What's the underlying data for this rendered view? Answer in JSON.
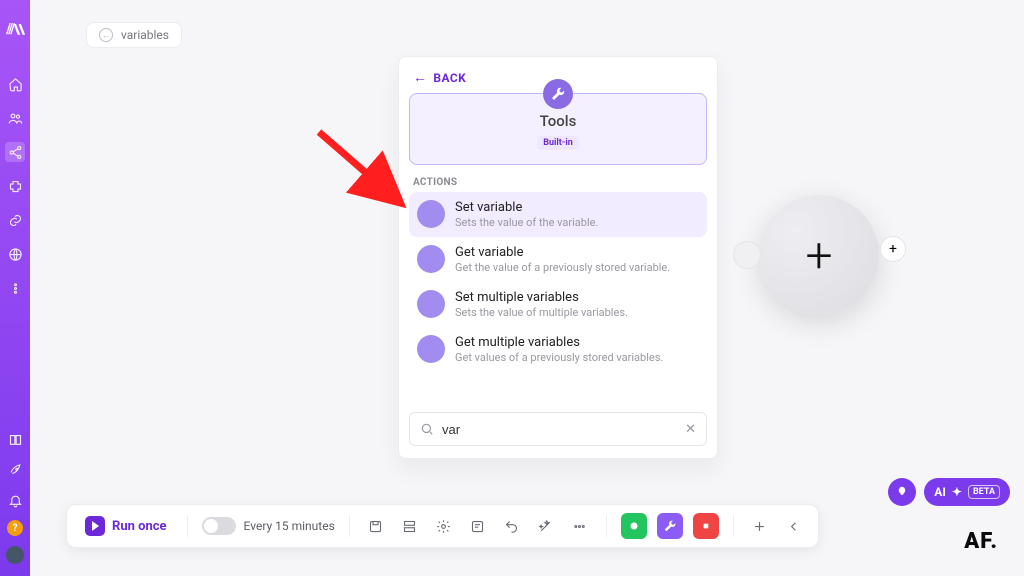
{
  "breadcrumb": {
    "label": "variables"
  },
  "panel": {
    "back_label": "BACK",
    "tool": {
      "title": "Tools",
      "tag": "Built-in"
    },
    "section_label": "ACTIONS",
    "actions": [
      {
        "title": "Set variable",
        "desc": "Sets the value of the variable.",
        "icon": "download"
      },
      {
        "title": "Get variable",
        "desc": "Get the value of a previously stored variable.",
        "icon": "upload"
      },
      {
        "title": "Set multiple variables",
        "desc": "Sets the value of multiple variables.",
        "icon": "upload"
      },
      {
        "title": "Get multiple variables",
        "desc": "Get values of a previously stored variables.",
        "icon": "upload"
      }
    ],
    "search": {
      "value": "var",
      "placeholder": ""
    }
  },
  "toolbar": {
    "run_label": "Run once",
    "schedule_label": "Every 15 minutes"
  },
  "ai_cta": {
    "label": "AI",
    "beta": "BETA"
  },
  "brand_mark": "AF.",
  "colors": {
    "accent": "#7c3aed",
    "accent_light": "#a38cf0"
  }
}
